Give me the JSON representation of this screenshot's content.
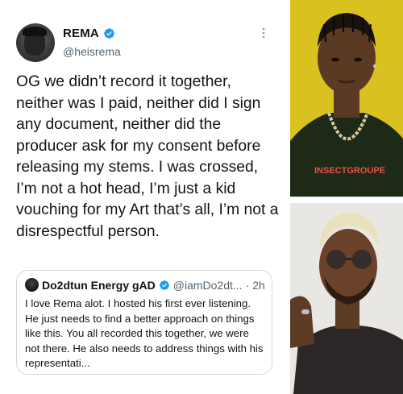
{
  "tweet": {
    "display_name": "REMA",
    "handle": "@heisrema",
    "text": "OG we didn’t record it together, neither was I paid, neither did I sign any document, neither did the producer ask for my consent before releasing my stems. I was crossed, I’m not a hot head, I’m just a kid vouching for my Art that’s all, I’m not a disrespectful person.",
    "more_icon": "more-icon"
  },
  "quote": {
    "display_name": "Do2dtun Energy gAD",
    "handle": "@iamDo2dt...",
    "separator": "·",
    "time": "2h",
    "text": "I love Rema alot. I hosted his first ever listening. He just needs to find a better approach on things like this. You all recorded this together, we were not there. He also needs to address things with his representati..."
  },
  "photos": {
    "top_shirt_text": "INSECTGROUPE",
    "top_bg": "#d9c21f",
    "bottom_bg": "#e9e7e4"
  },
  "colors": {
    "verified": "#1d9bf0",
    "text": "#0f1419",
    "muted": "#536471",
    "border": "#cfd9de"
  }
}
